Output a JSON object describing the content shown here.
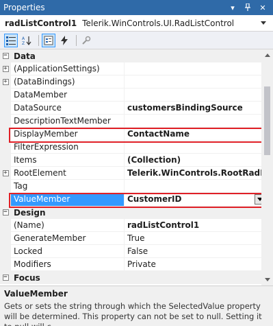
{
  "window": {
    "title": "Properties"
  },
  "object_selector": {
    "name": "radListControl1",
    "type": "Telerik.WinControls.UI.RadListControl"
  },
  "toolbar": {
    "buttons": [
      "categorized-icon",
      "alphabetical-icon",
      "properties-icon",
      "events-icon",
      "property-pages-icon"
    ]
  },
  "categories": {
    "data": "Data",
    "design": "Design",
    "focus": "Focus"
  },
  "data_rows": [
    {
      "name": "(ApplicationSettings)",
      "value": ""
    },
    {
      "name": "(DataBindings)",
      "value": ""
    },
    {
      "name": "DataMember",
      "value": ""
    },
    {
      "name": "DataSource",
      "value": "customersBindingSource"
    },
    {
      "name": "DescriptionTextMember",
      "value": ""
    },
    {
      "name": "DisplayMember",
      "value": "ContactName"
    },
    {
      "name": "FilterExpression",
      "value": ""
    },
    {
      "name": "Items",
      "value": "(Collection)"
    },
    {
      "name": "RootElement",
      "value": "Telerik.WinControls.RootRadElement"
    },
    {
      "name": "Tag",
      "value": ""
    },
    {
      "name": "ValueMember",
      "value": "CustomerID"
    }
  ],
  "design_rows": [
    {
      "name": "(Name)",
      "value": "radListControl1"
    },
    {
      "name": "GenerateMember",
      "value": "True"
    },
    {
      "name": "Locked",
      "value": "False"
    },
    {
      "name": "Modifiers",
      "value": "Private"
    }
  ],
  "description": {
    "title": "ValueMember",
    "text": "Gets or sets the string through which the SelectedValue property will be determined. This property can not be set to null. Setting it to null will c..."
  },
  "colors": {
    "titlebar": "#2f6aa8",
    "selection": "#3399ff",
    "highlight": "#e01f26"
  }
}
